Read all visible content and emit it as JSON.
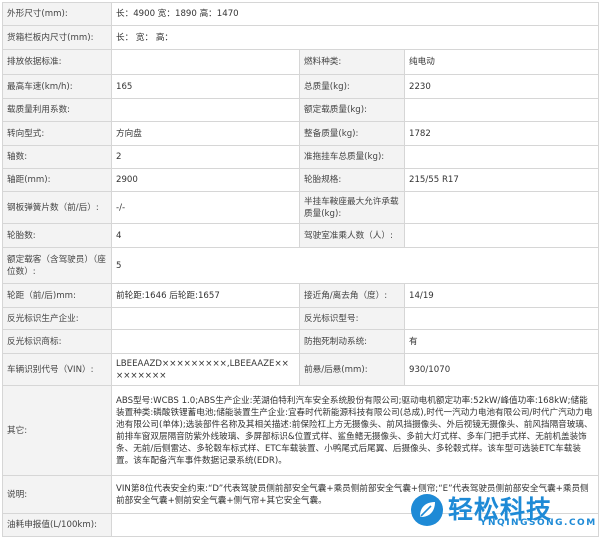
{
  "rows": [
    {
      "l1": "外形尺寸(mm):",
      "v1": "长：4900 宽：1890 高：1470"
    },
    {
      "l1": "货箱栏板内尺寸(mm):",
      "v1": "长： 宽： 高："
    },
    {
      "l1": "排放依据标准:",
      "v1": "",
      "l2": "燃料种类:",
      "v2": "纯电动"
    },
    {
      "l1": "最高车速(km/h):",
      "v1": "165",
      "l2": "总质量(kg):",
      "v2": "2230"
    },
    {
      "l1": "载质量利用系数:",
      "v1": "",
      "l2": "额定载质量(kg):",
      "v2": ""
    },
    {
      "l1": "转向型式:",
      "v1": "方向盘",
      "l2": "整备质量(kg):",
      "v2": "1782"
    },
    {
      "l1": "轴数:",
      "v1": "2",
      "l2": "准拖挂车总质量(kg):",
      "v2": ""
    },
    {
      "l1": "轴距(mm):",
      "v1": "2900",
      "l2": "轮胎规格:",
      "v2": "215/55 R17"
    },
    {
      "l1": "钢板弹簧片数（前/后）:",
      "v1": "-/-",
      "l2": "半挂车鞍座最大允许承载质量(kg):",
      "v2": ""
    },
    {
      "l1": "轮胎数:",
      "v1": "4",
      "l2": "驾驶室准乘人数（人）:",
      "v2": ""
    },
    {
      "l1": "额定载客（含驾驶员）（座位数）:",
      "v1": "5"
    },
    {
      "l1": "轮距（前/后)mm:",
      "v1": "前轮距:1646 后轮距:1657",
      "l2": "接近角/离去角（度）:",
      "v2": "14/19"
    },
    {
      "l1": "反光标识生产企业:",
      "v1": "",
      "l2": "反光标识型号:",
      "v2": ""
    },
    {
      "l1": "反光标识商标:",
      "v1": "",
      "l2": "防抱死制动系统:",
      "v2": "有"
    },
    {
      "l1": "车辆识别代号（VIN）:",
      "v1": "LBEEAAZD×××××××××,LBEEAAZE×××××××××",
      "l2": "前悬/后悬(mm):",
      "v2": "930/1070"
    },
    {
      "l1": "其它:",
      "v1": "ABS型号:WCBS 1.0;ABS生产企业:芜湖伯特利汽车安全系统股份有限公司;驱动电机额定功率:52kW/峰值功率:168kW;储能装置种类:磷酸铁锂蓄电池;储能装置生产企业:宜春时代新能源科技有限公司(总成),时代一汽动力电池有限公司/时代广汽动力电池有限公司(单体);选装部件名称及其相关描述:前保险杠上方无摄像头、前风挡摄像头、外后视镜无摄像头、前风挡隔音玻璃、前排车窗双层隔音防紫外线玻璃、多屏部标识&位置式样、鲨鱼鳍无摄像头、多前大灯式样、多车门把手式样、无前机盖装饰条、无前/后侧雷达、多轮毂车标式样、ETC车载装置、小鸭尾式后尾翼、后摄像头、多轮毂式样。该车型可选装ETC车载装置。该车配备汽车事件数据记录系统(EDR)。"
    },
    {
      "l1": "说明:",
      "v1": "VIN第8位代表安全约束:“D”代表驾驶员侧前部安全气囊+乘员侧前部安全气囊+侧帘;“E”代表驾驶员侧前部安全气囊+乘员侧前部安全气囊+侧前安全气囊+侧气帘+其它安全气囊。"
    },
    {
      "l1": "油耗申报值(L/100km):",
      "v1": ""
    }
  ],
  "watermark": {
    "text": "轻松科技",
    "subtext": "YNQINGSONG.COM",
    "color": "#1e8ad6"
  }
}
